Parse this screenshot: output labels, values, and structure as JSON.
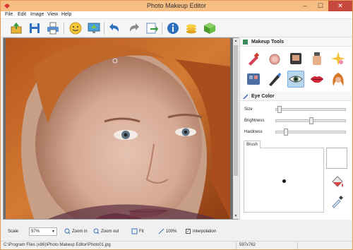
{
  "titlebar": {
    "title": "Photo Makeup Editor",
    "minimize": "–",
    "maximize": "☐",
    "close": "✕"
  },
  "menu": [
    "File",
    "Edit",
    "Image",
    "View",
    "Help"
  ],
  "toolbar": {
    "icons": [
      "open-icon",
      "save-icon",
      "print-icon",
      "face-icon",
      "monitor-icon",
      "undo-icon",
      "redo-icon",
      "export-icon",
      "info-icon",
      "coins-icon",
      "box-icon"
    ]
  },
  "makeup_tools": {
    "title": "Makeup Tools",
    "tools": [
      "lipstick-icon",
      "blush-icon",
      "foundation-icon",
      "lotion-icon",
      "sparkle-icon",
      "eyeshadow-icon",
      "eyeliner-icon",
      "eye-icon",
      "lips-icon",
      "hair-icon"
    ],
    "selected": "eye-icon"
  },
  "eye_color": {
    "title": "Eye Color",
    "sliders": [
      {
        "label": "Size",
        "value": 0.02
      },
      {
        "label": "Brightness",
        "value": 0.5
      },
      {
        "label": "Hardness",
        "value": 0.12
      }
    ],
    "brush_tab": "Brush"
  },
  "bottom": {
    "scale_label": "Scale",
    "scale_value": "97%",
    "zoom_in": "Zoom in",
    "zoom_out": "Zoom out",
    "fit": "Fit",
    "hundred": "100%",
    "interpolation": "Interpolation",
    "interpolation_checked": true
  },
  "status": {
    "path": "C:\\Program Files (x86)\\Photo Makeup Editor\\Photo01.jpg",
    "dimensions": "597x762"
  }
}
